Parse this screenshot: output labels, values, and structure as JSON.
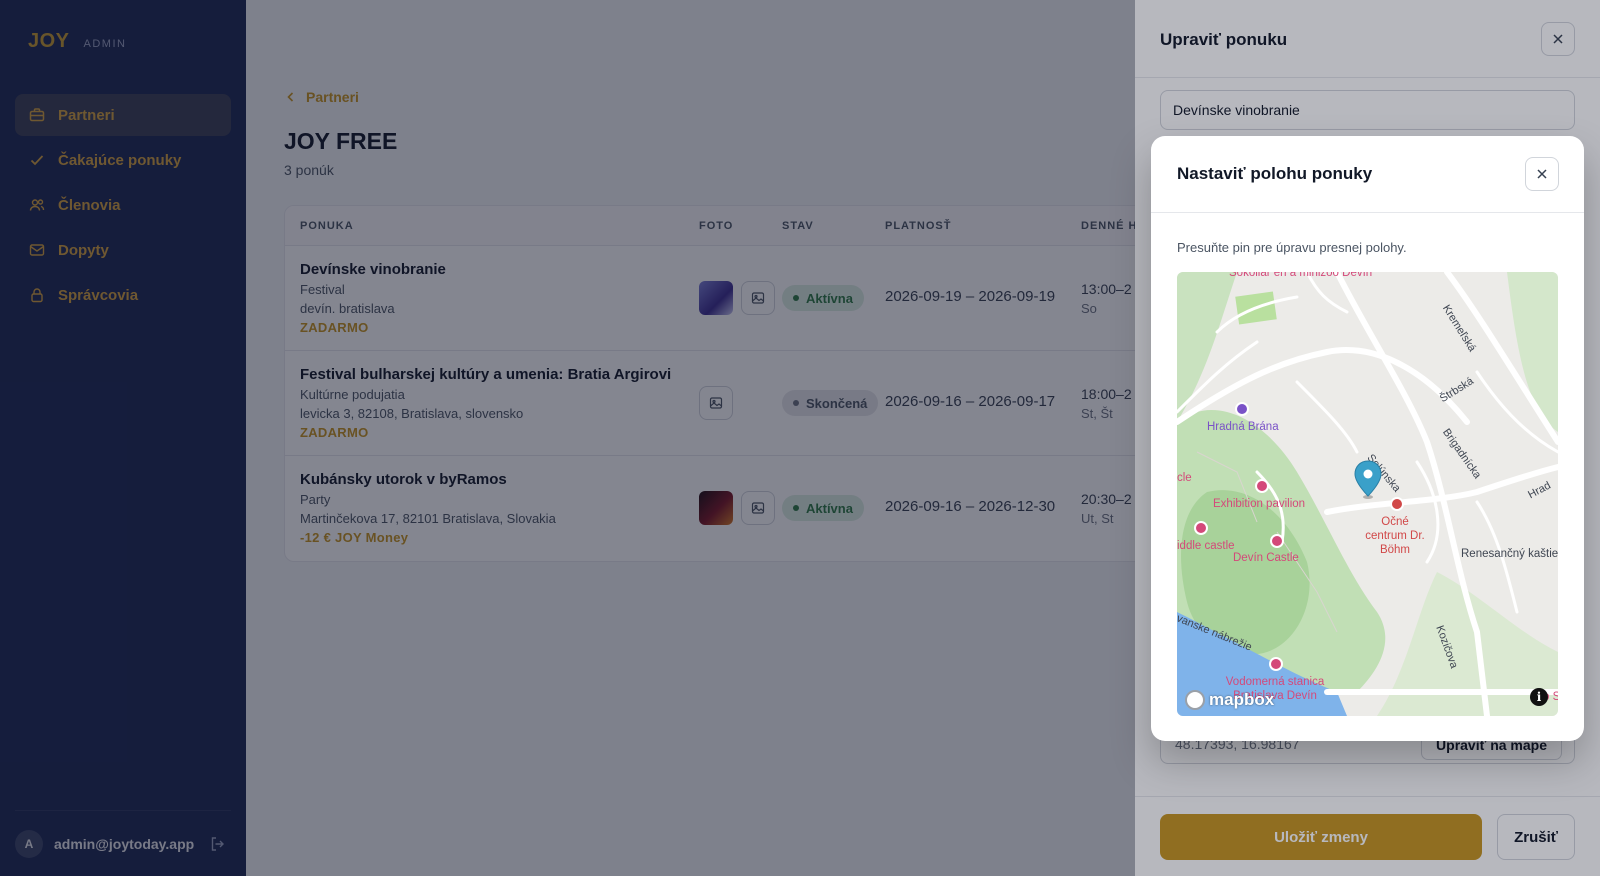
{
  "sidebar": {
    "logo_text": "JOY",
    "logo_sub": "ADMIN",
    "items": [
      {
        "label": "Partneri",
        "icon": "briefcase-icon",
        "active": true
      },
      {
        "label": "Čakajúce ponuky",
        "icon": "check-icon",
        "active": false
      },
      {
        "label": "Členovia",
        "icon": "users-icon",
        "active": false
      },
      {
        "label": "Dopyty",
        "icon": "mail-icon",
        "active": false
      },
      {
        "label": "Správcovia",
        "icon": "lock-icon",
        "active": false
      }
    ],
    "user": {
      "initial": "A",
      "email": "admin@joytoday.app"
    }
  },
  "main": {
    "breadcrumb": "Partneri",
    "title": "JOY FREE",
    "subtitle": "3 ponúk",
    "table": {
      "headers": [
        "PONUKA",
        "FOTO",
        "STAV",
        "PLATNOSŤ",
        "DENNÉ H"
      ],
      "rows": [
        {
          "name": "Devínske vinobranie",
          "category": "Festival",
          "address": "devín. bratislava",
          "price": "ZADARMO",
          "has_photo": true,
          "status": "Aktívna",
          "validity": "2026-09-19 – 2026-09-19",
          "time": "13:00–2",
          "days": "So"
        },
        {
          "name": "Festival bulharskej kultúry a umenia: Bratia Argirovi",
          "category": "Kultúrne podujatia",
          "address": "levicka 3, 82108, Bratislava, slovensko",
          "price": "ZADARMO",
          "has_photo": false,
          "status": "Skončená",
          "validity": "2026-09-16 – 2026-09-17",
          "time": "18:00–2",
          "days": "St, Št"
        },
        {
          "name": "Kubánsky utorok v byRamos",
          "category": "Party",
          "address": "Martinčekova 17, 82101 Bratislava, Slovakia",
          "price": "-12 € JOY Money",
          "has_photo": true,
          "status": "Aktívna",
          "validity": "2026-09-16 – 2026-12-30",
          "time": "20:30–2",
          "days": "Ut, St"
        }
      ]
    }
  },
  "drawer": {
    "title": "Upraviť ponuku",
    "name_value": "Devínske vinobranie",
    "coords_value": "48.17393, 16.98167",
    "edit_map_label": "Upraviť na mape",
    "save_label": "Uložiť zmeny",
    "cancel_label": "Zrušiť"
  },
  "modal": {
    "title": "Nastaviť polohu ponuky",
    "hint": "Presuňte pin pre úpravu presnej polohy.",
    "map": {
      "labels": [
        "Sokoliar en a minizoo Devín",
        "Hradná Brána",
        "Exhibition pavilion",
        "iddle castle",
        "Devín Castle",
        "Očné centrum Dr. Böhm",
        "Renesančný kaštie",
        "Vodomerná stanica Bratislava Devín",
        "cle",
        "o Sr"
      ],
      "streets": [
        "Kremeľská",
        "Štrbská",
        "Brigadnícka",
        "Solúnska",
        "Hrad",
        "Kozičova",
        "vanske nábrežie"
      ],
      "attribution": "mapbox",
      "info": "i"
    }
  },
  "colors": {
    "accent": "#c8961f",
    "sidebar_bg": "#1c2754",
    "pin": "#3aa0c9"
  }
}
